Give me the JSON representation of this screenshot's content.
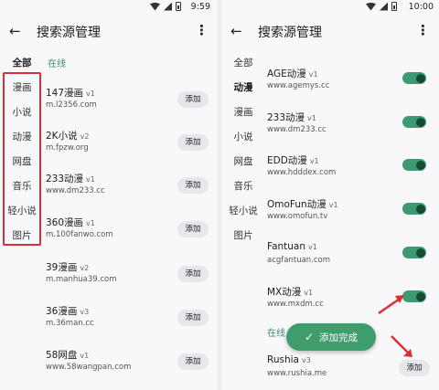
{
  "left": {
    "status": {
      "time": "9:59"
    },
    "appbar": {
      "title": "搜索源管理"
    },
    "categories": [
      "全部",
      "漫画",
      "小说",
      "动漫",
      "网盘",
      "音乐",
      "轻小说",
      "图片"
    ],
    "section_label": "在线",
    "items": [
      {
        "name": "147漫画",
        "version": "v1",
        "url": "m.l2356.com",
        "button": "添加"
      },
      {
        "name": "2K小说",
        "version": "v2",
        "url": "m.fpzw.org",
        "button": "添加"
      },
      {
        "name": "233动漫",
        "version": "v1",
        "url": "www.dm233.cc",
        "button": "添加"
      },
      {
        "name": "360漫画",
        "version": "v1",
        "url": "m.100fanwo.com",
        "button": "添加"
      },
      {
        "name": "39漫画",
        "version": "v2",
        "url": "m.manhua39.com",
        "button": "添加"
      },
      {
        "name": "36漫画",
        "version": "v3",
        "url": "m.36man.cc",
        "button": "添加"
      },
      {
        "name": "58网盘",
        "version": "v1",
        "url": "www.58wangpan.com",
        "button": "添加"
      }
    ]
  },
  "right": {
    "status": {
      "time": "10:00"
    },
    "appbar": {
      "title": "搜索源管理"
    },
    "categories": [
      "全部",
      "动漫",
      "漫画",
      "小说",
      "网盘",
      "音乐",
      "轻小说",
      "图片"
    ],
    "installed": [
      {
        "name": "AGE动漫",
        "version": "v1",
        "url": "www.agemys.cc",
        "enabled": true
      },
      {
        "name": "233动漫",
        "version": "v1",
        "url": "www.dm233.cc",
        "enabled": true
      },
      {
        "name": "EDD动漫",
        "version": "v1",
        "url": "www.hdddex.com",
        "enabled": true
      },
      {
        "name": "OmoFun动漫",
        "version": "v1",
        "url": "www.omofun.tv",
        "enabled": true
      },
      {
        "name": "Fantuan",
        "version": "v1",
        "url": "acgfantuan.com",
        "enabled": true
      },
      {
        "name": "MX动漫",
        "version": "v1",
        "url": "www.mxdm.cc",
        "enabled": true
      }
    ],
    "section_label": "在线",
    "online": [
      {
        "name": "Rushia",
        "version": "v3",
        "url": "www.rushia.me",
        "button": "添加"
      }
    ],
    "toast": "添加完成"
  },
  "colors": {
    "accent": "#3f9c6c",
    "annotation_red": "#d6303a"
  }
}
